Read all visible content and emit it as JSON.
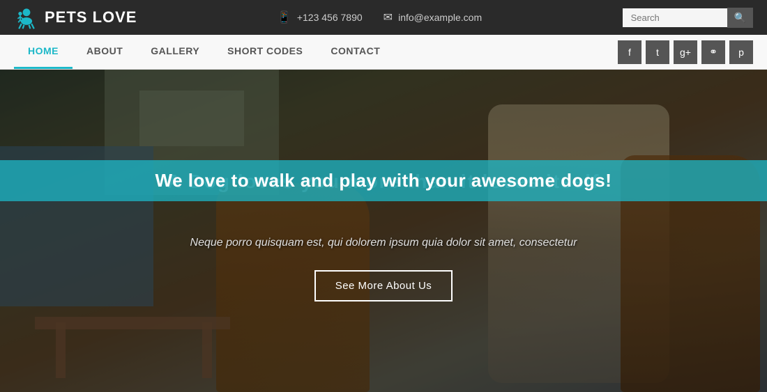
{
  "topbar": {
    "logo": {
      "text": "PETS LOVE",
      "icon_alt": "pets-love-logo"
    },
    "phone": {
      "icon": "📱",
      "number": "+123 456 7890"
    },
    "email": {
      "icon": "✉",
      "address": "info@example.com"
    },
    "search": {
      "placeholder": "Search",
      "button_label": "🔍"
    }
  },
  "nav": {
    "items": [
      {
        "label": "HOME",
        "active": true
      },
      {
        "label": "ABOUT",
        "active": false
      },
      {
        "label": "GALLERY",
        "active": false
      },
      {
        "label": "SHORT CODES",
        "active": false
      },
      {
        "label": "CONTACT",
        "active": false
      }
    ],
    "social": [
      {
        "label": "f",
        "name": "facebook"
      },
      {
        "label": "t",
        "name": "twitter"
      },
      {
        "label": "g+",
        "name": "google-plus"
      },
      {
        "label": "◎",
        "name": "rss"
      },
      {
        "label": "p",
        "name": "pinterest"
      }
    ]
  },
  "hero": {
    "bg_text": "A D...self",
    "main_text": "We love to walk and play with your awesome dogs!",
    "subtitle": "Neque porro quisquam est, qui dolorem ipsum quia dolor sit amet, consectetur",
    "cta_button": "See More About Us"
  },
  "colors": {
    "accent": "#1cb8c8",
    "dark_bg": "#2a2a2a",
    "nav_bg": "#f8f8f8"
  }
}
